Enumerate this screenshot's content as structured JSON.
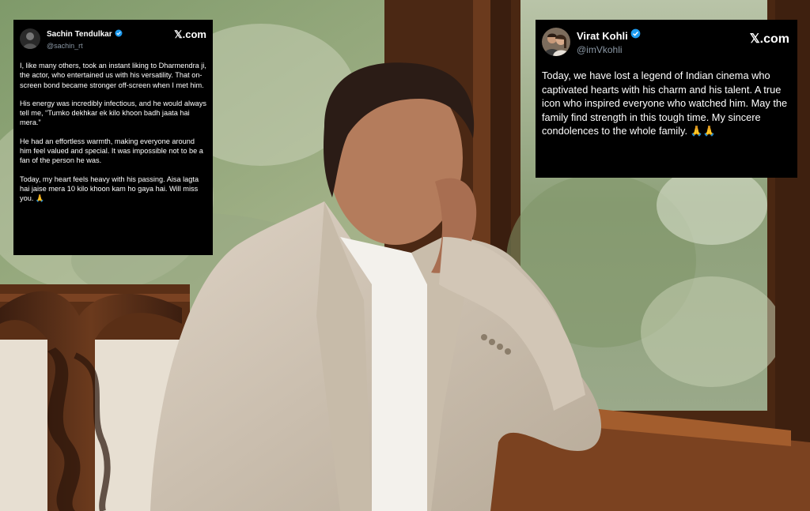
{
  "tweets": {
    "sachin": {
      "name": "Sachin Tendulkar",
      "handle": "@sachin_rt",
      "brand": "𝕏.com",
      "paragraphs": [
        "I, like many others, took an instant liking to Dharmendra ji, the actor, who entertained us with his versatility. That on-screen bond became stronger off-screen when I met him.",
        "His energy was incredibly infectious, and he would always tell me, “Tumko dekhkar ek kilo khoon badh jaata hai mera.”",
        "He had an effortless warmth, making everyone around him feel valued and special. It was impossible not to be a fan of the person he was.",
        "Today, my heart feels heavy with his passing. Aisa lagta hai jaise mera 10 kilo khoon kam ho gaya hai. Will miss you. 🙏"
      ]
    },
    "virat": {
      "name": "Virat Kohli",
      "handle": "@imVkohli",
      "brand": "𝕏.com",
      "text": "Today, we have lost a legend of Indian cinema who captivated hearts with his charm and his talent. A true icon who inspired everyone who watched him. May the family find strength in this tough time. My sincere condolences to the whole family. 🙏🙏"
    }
  },
  "colors": {
    "card_bg": "#000000",
    "handle": "#8b98a5",
    "verified": "#1d9bf0"
  }
}
